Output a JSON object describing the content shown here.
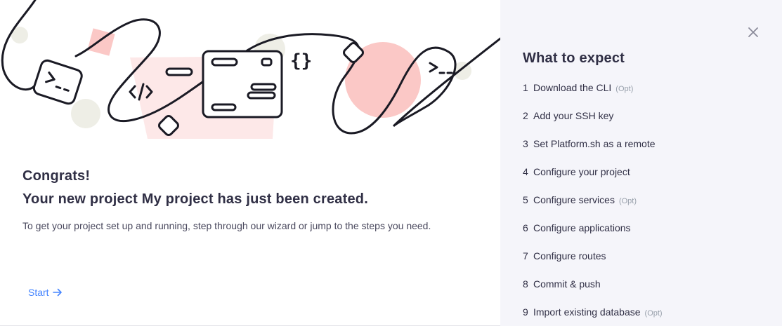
{
  "illustration": {
    "icons": [
      "terminal-prompt-icon",
      "code-tag-icon",
      "curly-braces-icon",
      "diamond-icon",
      "browser-window-icon"
    ],
    "colors": {
      "stroke": "#1a1a24",
      "pink": "#fbc8c6",
      "light_pink": "#fde8e8",
      "beige": "#eeeee6"
    }
  },
  "main": {
    "congrats": "Congrats!",
    "headline": "Your new project My project has just been created.",
    "intro": "To get your project set up and running, step through our wizard or jump to the steps you need.",
    "start_label": "Start",
    "accent_color": "#4786ff"
  },
  "sidebar": {
    "title": "What to expect",
    "close_icon": "close-icon",
    "steps": [
      {
        "num": "1",
        "label": "Download the CLI",
        "opt": "(Opt)"
      },
      {
        "num": "2",
        "label": "Add your SSH key",
        "opt": ""
      },
      {
        "num": "3",
        "label": "Set Platform.sh as a remote",
        "opt": ""
      },
      {
        "num": "4",
        "label": "Configure your project",
        "opt": ""
      },
      {
        "num": "5",
        "label": "Configure services",
        "opt": "(Opt)"
      },
      {
        "num": "6",
        "label": "Configure applications",
        "opt": ""
      },
      {
        "num": "7",
        "label": "Configure routes",
        "opt": ""
      },
      {
        "num": "8",
        "label": "Commit & push",
        "opt": ""
      },
      {
        "num": "9",
        "label": "Import existing database",
        "opt": "(Opt)"
      }
    ]
  }
}
